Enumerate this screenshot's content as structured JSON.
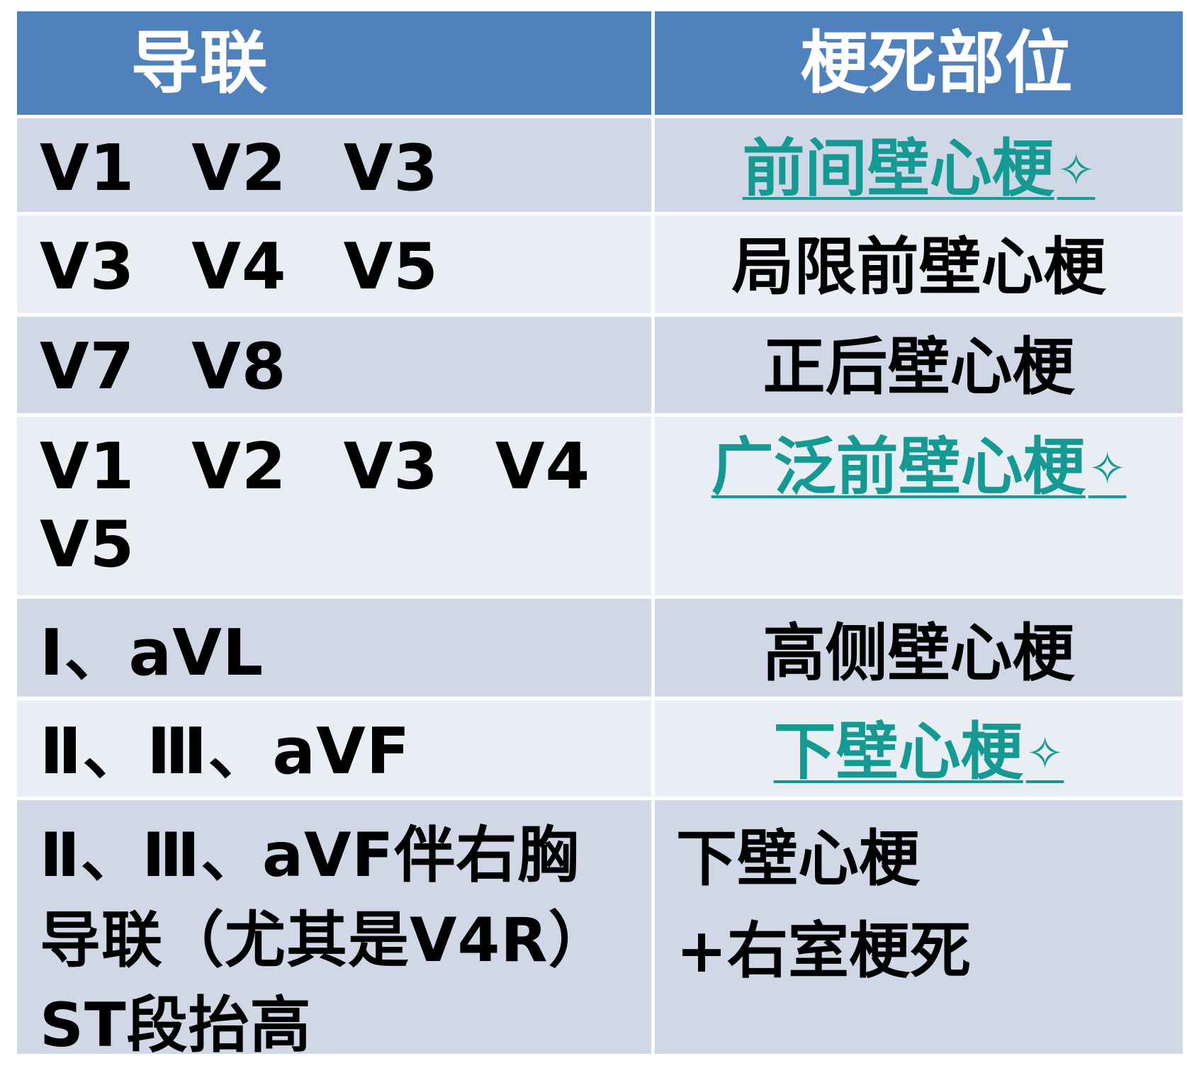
{
  "header": {
    "lead_col": "导联",
    "site_col": "梗死部位"
  },
  "rows": [
    {
      "lead": [
        "V1",
        "V2",
        "V3"
      ],
      "site": "前间壁心梗",
      "site_linked": true,
      "marker": "✧"
    },
    {
      "lead": [
        "V3",
        "V4",
        "V5"
      ],
      "site": "局限前壁心梗",
      "site_linked": false
    },
    {
      "lead": [
        "V7",
        "V8"
      ],
      "site": "正后壁心梗",
      "site_linked": false
    },
    {
      "lead": [
        "V1",
        "V2",
        "V3",
        "V4"
      ],
      "lead_line2": "V5",
      "site": "广泛前壁心梗",
      "site_linked": true,
      "marker": "✧"
    },
    {
      "lead_text": "Ⅰ、aVL",
      "site": "高侧壁心梗",
      "site_linked": false
    },
    {
      "lead_text": "Ⅱ、Ⅲ、aVF",
      "site": "下壁心梗",
      "site_linked": true,
      "marker": "✧"
    },
    {
      "lead_lines": [
        "Ⅱ、Ⅲ、aVF伴右胸",
        "导联（尤其是V4R）",
        "ST段抬高"
      ],
      "site_lines": [
        "下壁心梗",
        "+右室梗死"
      ],
      "site_linked": false
    }
  ]
}
